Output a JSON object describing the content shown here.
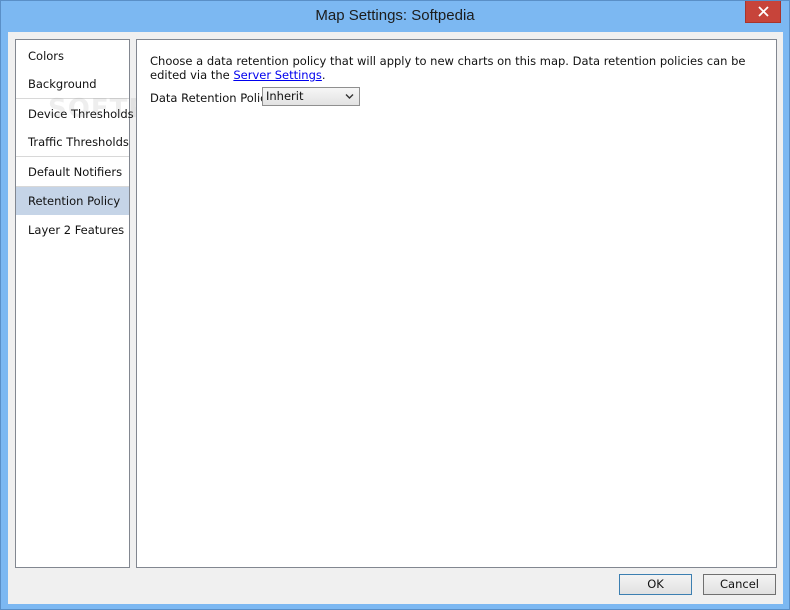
{
  "window": {
    "title": "Map Settings: Softpedia"
  },
  "sidebar": {
    "items": [
      {
        "label": "Colors"
      },
      {
        "label": "Background"
      },
      {
        "label": "Device Thresholds"
      },
      {
        "label": "Traffic Thresholds"
      },
      {
        "label": "Default Notifiers"
      },
      {
        "label": "Retention Policy",
        "selected": true
      },
      {
        "label": "Layer 2 Features"
      }
    ]
  },
  "content": {
    "description": "Choose a data retention policy that will apply to new charts on this map. Data retention policies can be edited via the ",
    "link_text": "Server Settings",
    "description_end": ".",
    "policy_label": "Data Retention Policy:",
    "policy_value": "Inherit"
  },
  "buttons": {
    "ok": "OK",
    "cancel": "Cancel"
  },
  "watermark": "SOFTPEDIA",
  "colors": {
    "titlebar": "#7cb8f2",
    "close_button": "#c7443a",
    "selected_item": "#c5d4e7",
    "link": "#0000ee"
  }
}
